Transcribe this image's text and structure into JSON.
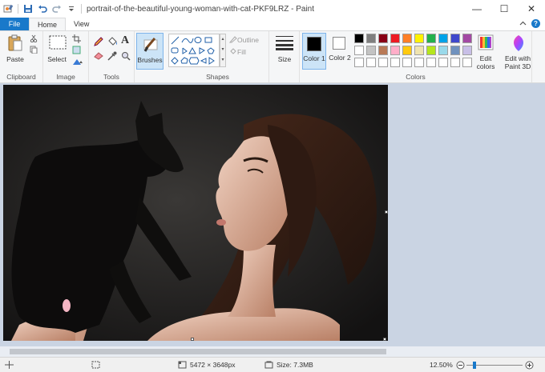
{
  "window": {
    "title": "portrait-of-the-beautiful-young-woman-with-cat-PKF9LRZ - Paint",
    "minimize": "—",
    "maximize": "☐",
    "close": "✕"
  },
  "tabs": [
    {
      "label": "File"
    },
    {
      "label": "Home"
    },
    {
      "label": "View"
    }
  ],
  "ribbon": {
    "clipboard": {
      "paste": "Paste",
      "group": "Clipboard"
    },
    "image": {
      "select": "Select",
      "group": "Image"
    },
    "tools": {
      "group": "Tools"
    },
    "brushes": {
      "label": "Brushes"
    },
    "shapes": {
      "outline": "Outline",
      "fill": "Fill",
      "group": "Shapes"
    },
    "size": {
      "label": "Size"
    },
    "colors": {
      "color1": "Color 1",
      "color2": "Color 2",
      "edit": "Edit colors",
      "paint3d": "Edit with Paint 3D",
      "group": "Colors",
      "color1_value": "#000000",
      "color2_value": "#ffffff",
      "row1": [
        "#000000",
        "#7f7f7f",
        "#880015",
        "#ed1c24",
        "#ff7f27",
        "#fff200",
        "#22b14c",
        "#00a2e8",
        "#3f48cc",
        "#a349a4"
      ],
      "row2": [
        "#ffffff",
        "#c3c3c3",
        "#b97a57",
        "#ffaec9",
        "#ffc90e",
        "#efe4b0",
        "#b5e61d",
        "#99d9ea",
        "#7092be",
        "#c8bfe7"
      ],
      "row3": [
        "#ffffff",
        "#ffffff",
        "#ffffff",
        "#ffffff",
        "#ffffff",
        "#ffffff",
        "#ffffff",
        "#ffffff",
        "#ffffff",
        "#ffffff"
      ]
    }
  },
  "status": {
    "dimensions": "5472 × 3648px",
    "size": "Size: 7.3MB",
    "zoom": "12.50%",
    "zoom_level": 0.12
  }
}
